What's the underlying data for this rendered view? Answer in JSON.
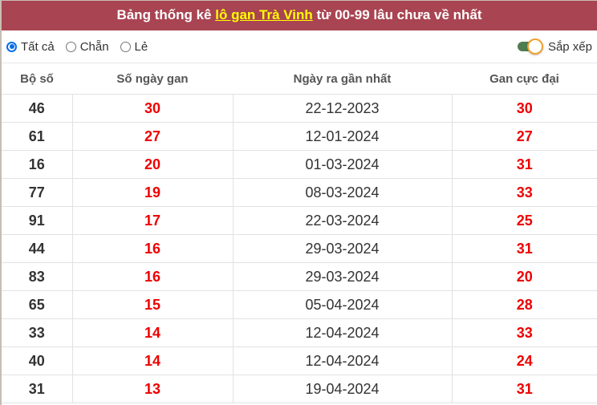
{
  "header": {
    "title_prefix": "Bảng thống kê ",
    "title_link": "lô gan Trà Vinh",
    "title_suffix": " từ 00-99 lâu chưa về nhất",
    "background_color": "#a94452",
    "link_color": "#ffff00"
  },
  "filters": {
    "options": [
      {
        "label": "Tất cả",
        "selected": true
      },
      {
        "label": "Chẵn",
        "selected": false
      },
      {
        "label": "Lẻ",
        "selected": false
      }
    ],
    "sort_label": "Sắp xếp",
    "sort_on": true
  },
  "table": {
    "columns": [
      "Bộ số",
      "Số ngày gan",
      "Ngày ra gần nhất",
      "Gan cực đại"
    ],
    "rows": [
      {
        "bo_so": "46",
        "so_ngay_gan": "30",
        "ngay_ra": "22-12-2023",
        "gan_cuc_dai": "30"
      },
      {
        "bo_so": "61",
        "so_ngay_gan": "27",
        "ngay_ra": "12-01-2024",
        "gan_cuc_dai": "27"
      },
      {
        "bo_so": "16",
        "so_ngay_gan": "20",
        "ngay_ra": "01-03-2024",
        "gan_cuc_dai": "31"
      },
      {
        "bo_so": "77",
        "so_ngay_gan": "19",
        "ngay_ra": "08-03-2024",
        "gan_cuc_dai": "33"
      },
      {
        "bo_so": "91",
        "so_ngay_gan": "17",
        "ngay_ra": "22-03-2024",
        "gan_cuc_dai": "25"
      },
      {
        "bo_so": "44",
        "so_ngay_gan": "16",
        "ngay_ra": "29-03-2024",
        "gan_cuc_dai": "31"
      },
      {
        "bo_so": "83",
        "so_ngay_gan": "16",
        "ngay_ra": "29-03-2024",
        "gan_cuc_dai": "20"
      },
      {
        "bo_so": "65",
        "so_ngay_gan": "15",
        "ngay_ra": "05-04-2024",
        "gan_cuc_dai": "28"
      },
      {
        "bo_so": "33",
        "so_ngay_gan": "14",
        "ngay_ra": "12-04-2024",
        "gan_cuc_dai": "33"
      },
      {
        "bo_so": "40",
        "so_ngay_gan": "14",
        "ngay_ra": "12-04-2024",
        "gan_cuc_dai": "24"
      },
      {
        "bo_so": "31",
        "so_ngay_gan": "13",
        "ngay_ra": "19-04-2024",
        "gan_cuc_dai": "31"
      }
    ]
  }
}
